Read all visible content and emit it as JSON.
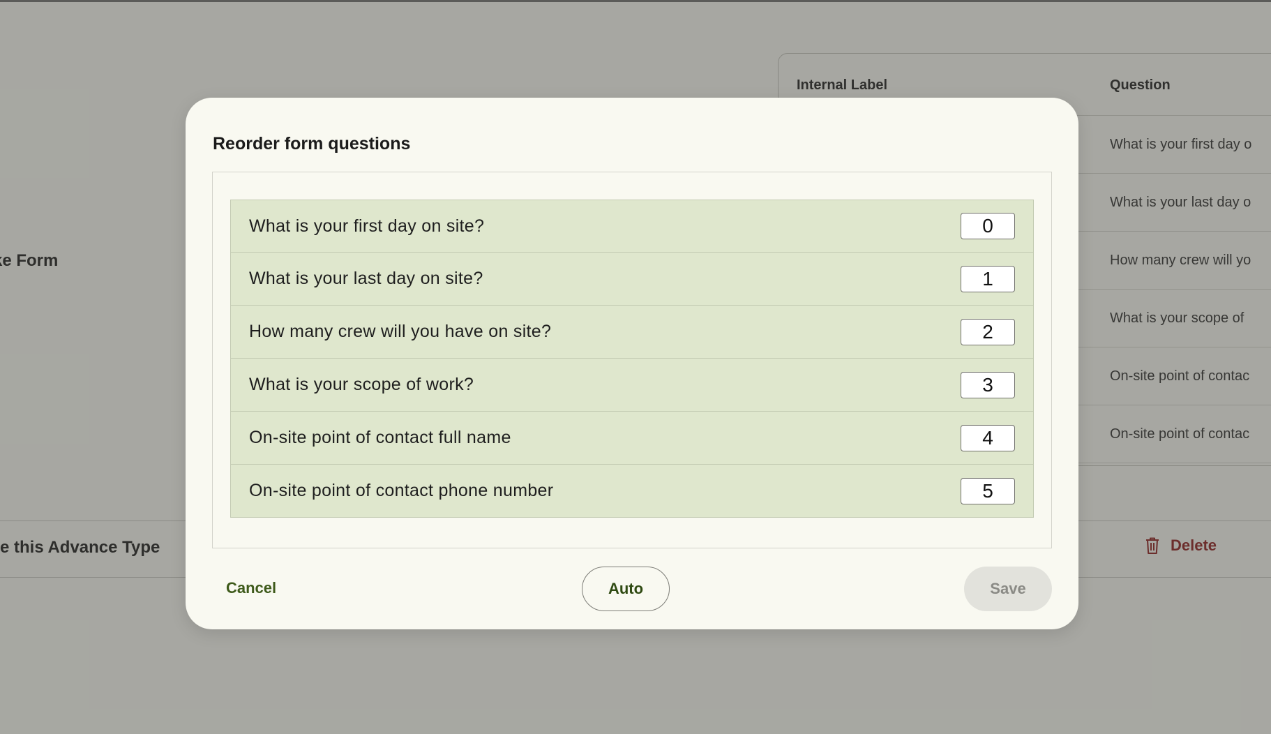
{
  "background": {
    "section_title": "ke Form",
    "table": {
      "headers": {
        "label": "Internal Label",
        "question": "Question"
      },
      "rows": [
        "What is your first day o",
        "What is your last day o",
        "How many crew will yo",
        "What is your scope of ",
        "On-site point of contac",
        "On-site point of contac"
      ]
    },
    "delete_section": {
      "title": "te this Advance Type",
      "button_label": "Delete",
      "button_icon": "trash-icon"
    }
  },
  "modal": {
    "title": "Reorder form questions",
    "questions": [
      {
        "text": "What is your first day on site?",
        "order": "0"
      },
      {
        "text": "What is your last day on site?",
        "order": "1"
      },
      {
        "text": "How many crew will you have on site?",
        "order": "2"
      },
      {
        "text": "What is your scope of work?",
        "order": "3"
      },
      {
        "text": "On-site point of contact full name",
        "order": "4"
      },
      {
        "text": "On-site point of contact phone number",
        "order": "5"
      }
    ],
    "buttons": {
      "cancel": "Cancel",
      "auto": "Auto",
      "save": "Save"
    }
  },
  "colors": {
    "row_background": "#dfe7cd",
    "accent_green": "#3e5a1a",
    "delete_red": "#8b1a1a",
    "disabled_save": "#e2e2dc"
  }
}
